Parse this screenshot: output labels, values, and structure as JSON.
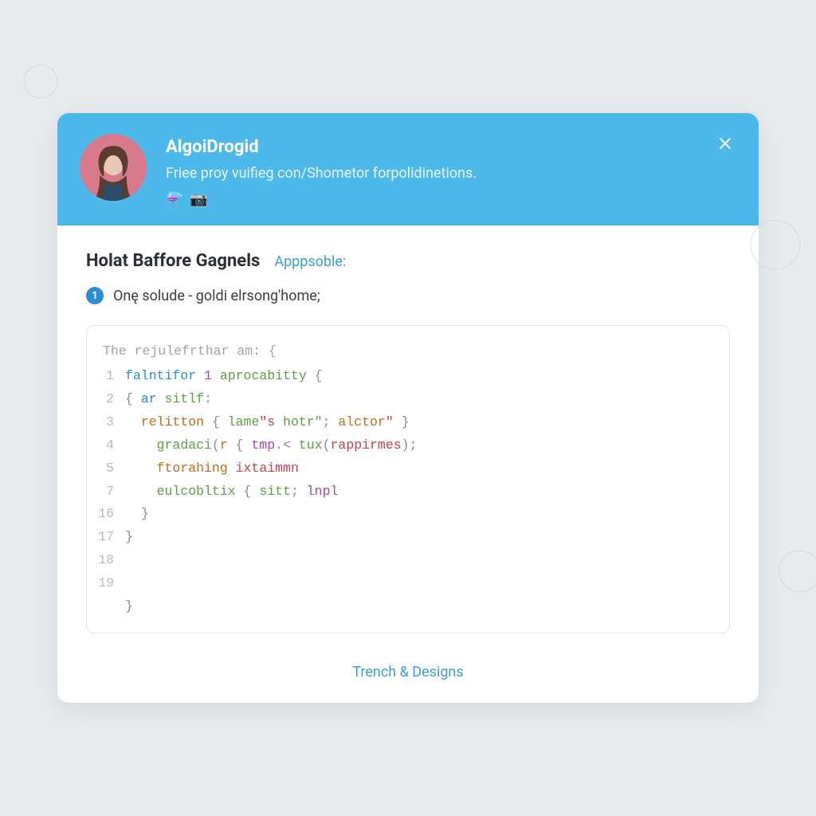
{
  "header": {
    "username": "AlgoiDrogid",
    "tagline": "Friee proy vuifieg con/Shometor forpolidinetions.",
    "badges": [
      "flask-icon",
      "camera-icon"
    ]
  },
  "body": {
    "title": "Holat Baffore Gagnels",
    "sublink": "Apppsoble:",
    "step_number": "1",
    "step_text": "Onę solude - goldi elrsong'home;"
  },
  "code": {
    "comment": "The rejulefrthar am: {",
    "lines": [
      {
        "n": "1",
        "segs": [
          [
            "t-key",
            "falntifor "
          ],
          [
            "t-num",
            "1 "
          ],
          [
            "t-fn",
            "aprocabitty "
          ],
          [
            "t-punc",
            "{"
          ]
        ]
      },
      {
        "n": "2",
        "segs": [
          [
            "t-punc",
            "{ "
          ],
          [
            "t-key",
            "ar "
          ],
          [
            "t-ident",
            "sitlf"
          ],
          [
            "t-punc",
            ":"
          ]
        ]
      },
      {
        "n": "3",
        "segs": [
          [
            "",
            "  "
          ],
          [
            "t-type",
            "relitton "
          ],
          [
            "t-punc",
            "{ "
          ],
          [
            "t-fn",
            "lame"
          ],
          [
            "t-str",
            "\"s "
          ],
          [
            "t-fn",
            "hotr\""
          ],
          [
            "t-punc",
            "; "
          ],
          [
            "t-type",
            "alctor"
          ],
          [
            "t-str",
            "\""
          ],
          [
            "t-punc",
            " }"
          ]
        ]
      },
      {
        "n": "4",
        "segs": [
          [
            "",
            "    "
          ],
          [
            "t-fn",
            "gradaci"
          ],
          [
            "t-punc",
            "("
          ],
          [
            "t-type",
            "r "
          ],
          [
            "t-punc",
            "{ "
          ],
          [
            "t-member",
            "tmp"
          ],
          [
            "t-punc",
            ".< "
          ],
          [
            "t-fn",
            "tux"
          ],
          [
            "t-punc",
            "("
          ],
          [
            "t-str",
            "rappirmes"
          ],
          [
            "t-punc",
            ");"
          ]
        ]
      },
      {
        "n": "5",
        "segs": [
          [
            "",
            "    "
          ],
          [
            "t-type",
            "ftorahing "
          ],
          [
            "t-str",
            "ixtaimmn"
          ]
        ]
      },
      {
        "n": "7",
        "segs": [
          [
            "",
            "    "
          ],
          [
            "t-fn",
            "eulcobltix "
          ],
          [
            "t-punc",
            "{ "
          ],
          [
            "t-ident",
            "sitt"
          ],
          [
            "t-punc",
            "; "
          ],
          [
            "t-member",
            "lnpl"
          ]
        ]
      },
      {
        "n": "16",
        "segs": [
          [
            "",
            "  "
          ],
          [
            "t-punc",
            "}"
          ]
        ]
      },
      {
        "n": "17",
        "segs": [
          [
            "t-punc",
            "}"
          ]
        ]
      },
      {
        "n": "18",
        "segs": [
          [
            "",
            ""
          ]
        ]
      },
      {
        "n": "19",
        "segs": [
          [
            "",
            ""
          ]
        ]
      },
      {
        "n": "",
        "segs": [
          [
            "t-punc",
            "}"
          ]
        ]
      }
    ]
  },
  "footer": {
    "link": "Trench & Designs"
  }
}
